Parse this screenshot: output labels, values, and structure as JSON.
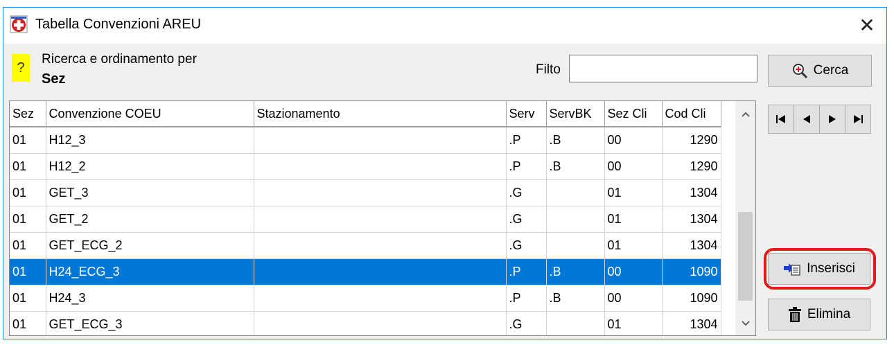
{
  "window": {
    "title": "Tabella Convenzioni AREU"
  },
  "search": {
    "help": "?",
    "line1": "Ricerca e ordinamento per",
    "sort_key": "Sez"
  },
  "filter": {
    "label": "Filto",
    "value": ""
  },
  "buttons": {
    "search": "Cerca",
    "insert": "Inserisci",
    "delete": "Elimina"
  },
  "table": {
    "columns": [
      "Sez",
      "Convenzione COEU",
      "Stazionamento",
      "Serv",
      "ServBK",
      "Sez Cli",
      "Cod Cli"
    ],
    "rows": [
      [
        "01",
        "H12_3",
        "",
        ".P",
        ".B",
        "00",
        "1290"
      ],
      [
        "01",
        "H12_2",
        "",
        ".P",
        ".B",
        "00",
        "1290"
      ],
      [
        "01",
        "GET_3",
        "",
        ".G",
        "",
        "01",
        "1304"
      ],
      [
        "01",
        "GET_2",
        "",
        ".G",
        "",
        "01",
        "1304"
      ],
      [
        "01",
        "GET_ECG_2",
        "",
        ".G",
        "",
        "01",
        "1304"
      ],
      [
        "01",
        "H24_ECG_3",
        "",
        ".P",
        ".B",
        "00",
        "1090"
      ],
      [
        "01",
        "H24_3",
        "",
        ".P",
        ".B",
        "00",
        "1090"
      ],
      [
        "01",
        "GET_ECG_3",
        "",
        ".G",
        "",
        "01",
        "1304"
      ]
    ],
    "selected_row": 5
  },
  "icons": {
    "app": "red-cross-app-icon",
    "close": "close-icon",
    "search": "zoom-in-icon",
    "insert": "insert-record-icon",
    "delete": "trash-icon",
    "nav": [
      "first-record-icon",
      "prev-record-icon",
      "next-record-icon",
      "last-record-icon"
    ]
  },
  "colors": {
    "selection": "#0078d7",
    "highlight": "#e01b1b",
    "help_bg": "#ffff00"
  }
}
